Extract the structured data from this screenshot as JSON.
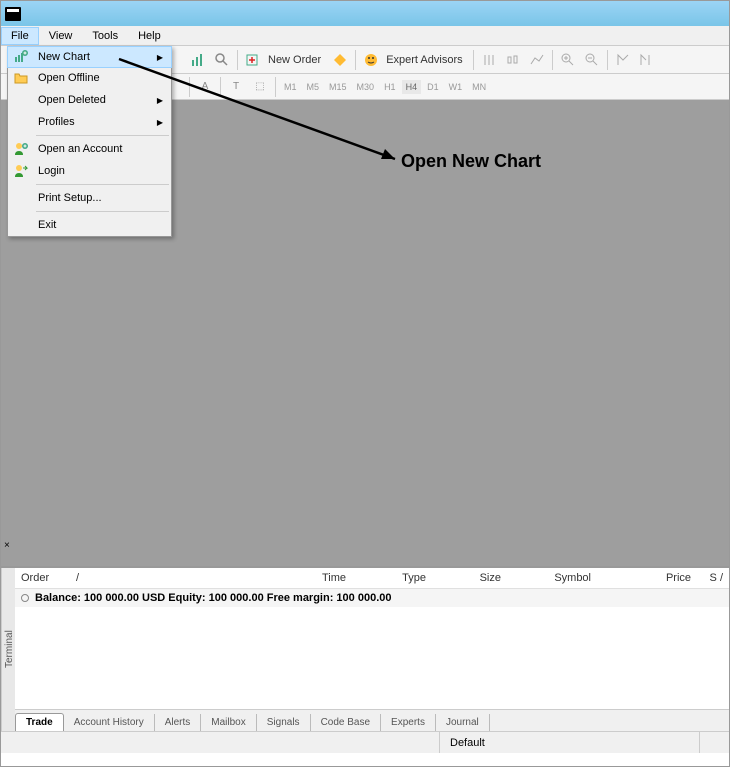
{
  "titlebar": {
    "text": ""
  },
  "menubar": {
    "items": [
      "File",
      "View",
      "Tools",
      "Help"
    ],
    "active_index": 0
  },
  "toolbar": {
    "new_order": "New Order",
    "expert_advisors": "Expert Advisors"
  },
  "toolbar2": {
    "timeframes": [
      "M1",
      "M5",
      "M15",
      "M30",
      "H1",
      "H4",
      "D1",
      "W1",
      "MN"
    ],
    "tf_active": "H4",
    "text_a": "A",
    "text_t": "T"
  },
  "file_menu": {
    "items": [
      {
        "label": "New Chart",
        "icon": "chart-plus-icon",
        "submenu": true
      },
      {
        "label": "Open Offline",
        "icon": "folder-icon"
      },
      {
        "label": "Open Deleted",
        "submenu": true
      },
      {
        "label": "Profiles",
        "submenu": true
      },
      {
        "sep": true
      },
      {
        "label": "Open an Account",
        "icon": "user-plus-icon"
      },
      {
        "label": "Login",
        "icon": "user-login-icon"
      },
      {
        "sep": true
      },
      {
        "label": "Print Setup..."
      },
      {
        "sep": true
      },
      {
        "label": "Exit"
      }
    ]
  },
  "annotation": {
    "text": "Open New Chart"
  },
  "terminal": {
    "side_label": "Terminal",
    "close": "×",
    "columns": [
      "Order",
      "/",
      "Time",
      "Type",
      "Size",
      "Symbol",
      "Price",
      "S /"
    ],
    "balance_row": "Balance: 100 000.00 USD  Equity: 100 000.00  Free margin: 100 000.00",
    "tabs": [
      "Trade",
      "Account History",
      "Alerts",
      "Mailbox",
      "Signals",
      "Code Base",
      "Experts",
      "Journal"
    ],
    "active_tab": 0
  },
  "statusbar": {
    "default": "Default"
  }
}
